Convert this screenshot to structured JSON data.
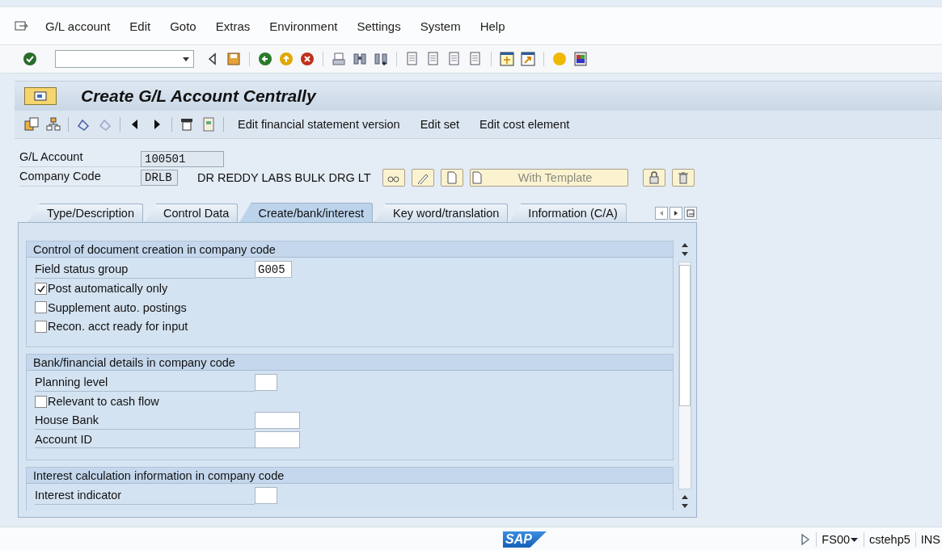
{
  "menu": [
    {
      "label": "G/L account"
    },
    {
      "label": "Edit"
    },
    {
      "label": "Goto"
    },
    {
      "label": "Extras"
    },
    {
      "label": "Environment"
    },
    {
      "label": "Settings"
    },
    {
      "label": "System"
    },
    {
      "label": "Help"
    }
  ],
  "title": "Create G/L Account Centrally",
  "app_toolbar": {
    "buttons": [
      "Edit financial statement version",
      "Edit set",
      "Edit cost element"
    ]
  },
  "header": {
    "gl_account": {
      "label": "G/L Account",
      "value": "100501"
    },
    "company_code": {
      "label": "Company Code",
      "value": "DRLB",
      "description": "DR REDDY LABS BULK DRG LT"
    },
    "template_button": "With Template"
  },
  "tabs": [
    {
      "label": "Type/Description",
      "selected": false
    },
    {
      "label": "Control Data",
      "selected": false
    },
    {
      "label": "Create/bank/interest",
      "selected": true
    },
    {
      "label": "Key word/translation",
      "selected": false
    },
    {
      "label": "Information (C/A)",
      "selected": false
    }
  ],
  "sections": [
    {
      "title": "Control of document creation in company code",
      "rows": [
        {
          "kind": "field",
          "label": "Field status group",
          "value": "G005"
        },
        {
          "kind": "checkbox",
          "label": "Post automatically only",
          "checked": true
        },
        {
          "kind": "checkbox",
          "label": "Supplement auto. postings",
          "checked": false
        },
        {
          "kind": "checkbox",
          "label": "Recon. acct ready for input",
          "checked": false
        }
      ]
    },
    {
      "title": "Bank/financial details in company code",
      "rows": [
        {
          "kind": "field",
          "label": "Planning level",
          "value": ""
        },
        {
          "kind": "checkbox",
          "label": "Relevant to cash flow",
          "checked": false
        },
        {
          "kind": "wide-field",
          "label": "House Bank",
          "value": ""
        },
        {
          "kind": "wide-field",
          "label": "Account ID",
          "value": ""
        }
      ]
    },
    {
      "title": "Interest calculation information in company code",
      "rows": [
        {
          "kind": "field",
          "label": "Interest indicator",
          "value": ""
        }
      ]
    }
  ],
  "status_bar": {
    "logo": "SAP",
    "transaction": "FS00",
    "server": "cstehp5",
    "mode": "INS"
  }
}
